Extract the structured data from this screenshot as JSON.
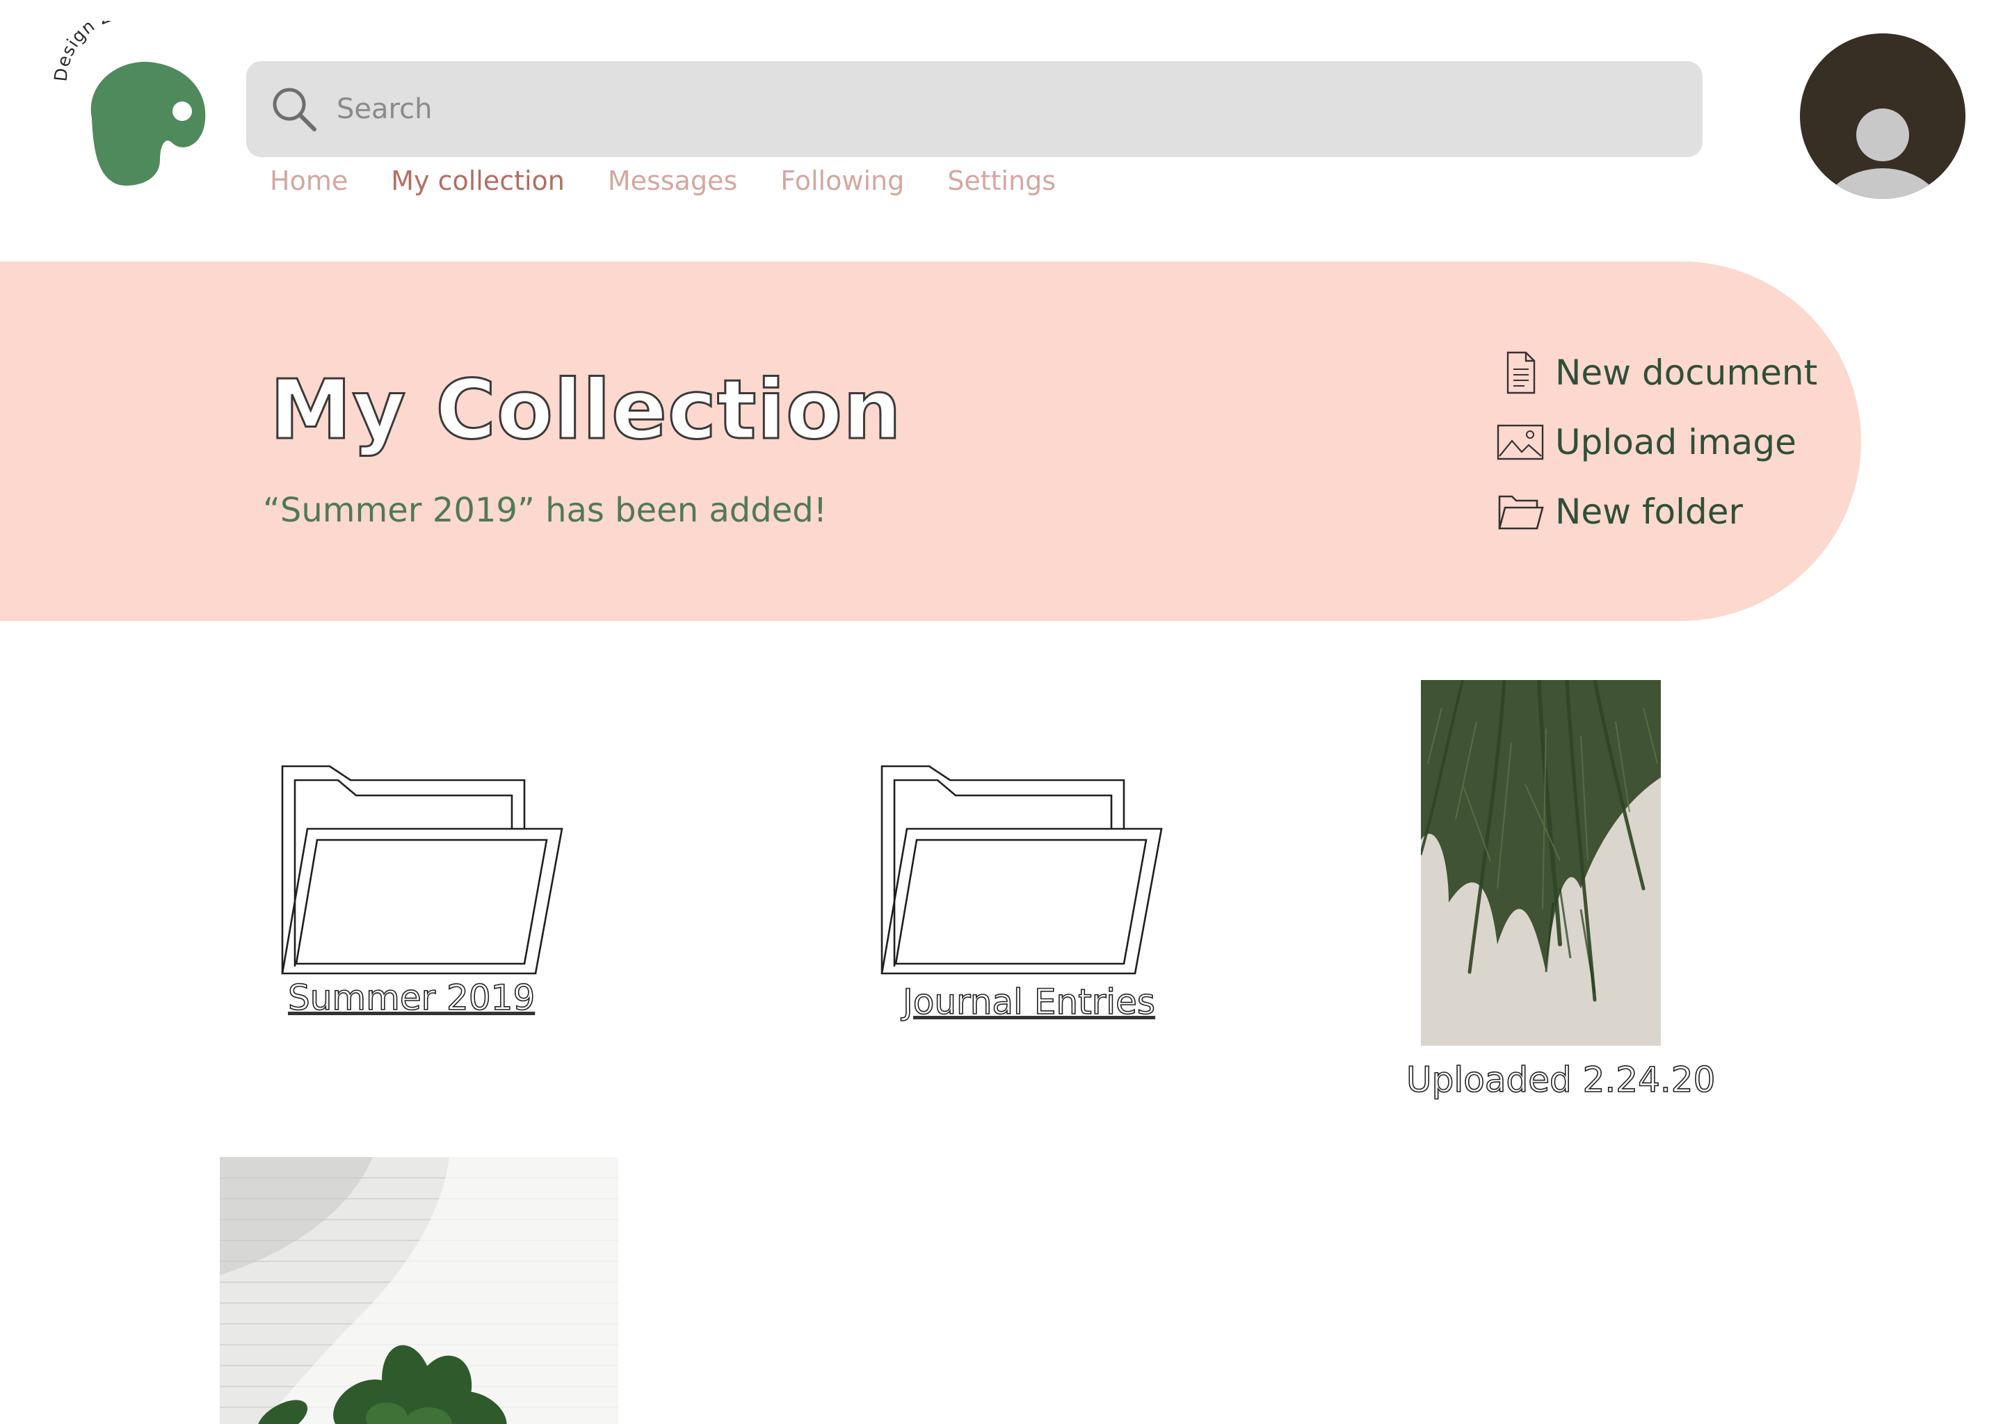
{
  "app": {
    "brand_text": "Design Zen",
    "colors": {
      "brand_green": "#4f8a5c",
      "nav_inactive": "#d4a79f",
      "nav_active": "#b26e63",
      "banner_bg": "#fdd8ce",
      "message_green": "#4f7a55",
      "avatar_bg": "#372e24"
    }
  },
  "header": {
    "search": {
      "placeholder": "Search",
      "icon": "search-icon"
    },
    "nav": [
      {
        "label": "Home",
        "active": false
      },
      {
        "label": "My collection",
        "active": true
      },
      {
        "label": "Messages",
        "active": false
      },
      {
        "label": "Following",
        "active": false
      },
      {
        "label": "Settings",
        "active": false
      }
    ],
    "avatar_icon": "user-avatar-icon"
  },
  "banner": {
    "title": "My Collection",
    "message": "“Summer 2019” has been added!",
    "actions": [
      {
        "label": "New document",
        "icon": "document-icon"
      },
      {
        "label": "Upload image",
        "icon": "image-icon"
      },
      {
        "label": "New folder",
        "icon": "folder-icon"
      }
    ]
  },
  "collection": {
    "folders": [
      {
        "name": "Summer 2019",
        "icon": "folder-icon"
      },
      {
        "name": "Journal Entries",
        "icon": "folder-icon"
      }
    ],
    "images": [
      {
        "caption": "Uploaded 2.24.20",
        "subject": "palm leaves"
      },
      {
        "caption": "",
        "subject": "plant against white brick wall"
      }
    ]
  }
}
